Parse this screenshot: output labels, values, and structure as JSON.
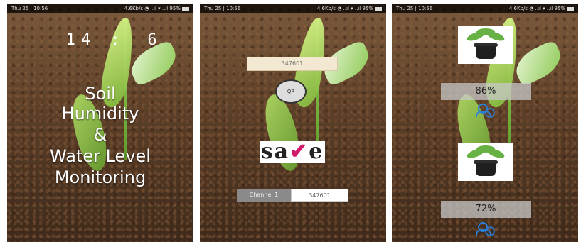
{
  "screens": [
    {
      "status_left": "Thu 25 | 10:56",
      "status_right": "4.6Kb/s  ◔  ..ıl  ▾  ..ıl  95%",
      "timer_hours": "14",
      "timer_sep": ":",
      "timer_minutes": "6",
      "title_lines": [
        "Soil",
        "Humidity",
        "&",
        "Water Level",
        "Monitoring"
      ]
    },
    {
      "status_left": "Thu 25 | 10:56",
      "status_right": "4.6Kb/s  ◔  ..ıl  ▾  ..ıl  95%",
      "id_value": "347601",
      "qr_label": "QR",
      "save_label_left": "sa",
      "save_label_tick": "✔",
      "save_label_right": "e",
      "channel_label": "Channel 1",
      "channel_value": "347601"
    },
    {
      "status_left": "Thu 25 | 10:56",
      "status_right": "4.6Kb/s  ◔  ..ıl  ▾  ..ıl  95%",
      "soil_humidity": "86%",
      "water_level": "72%"
    }
  ]
}
